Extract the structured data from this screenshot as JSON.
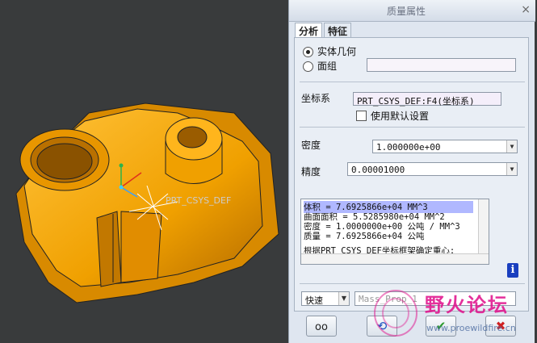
{
  "dialog": {
    "title": "质量属性",
    "tabs": [
      "分析",
      "特征"
    ],
    "options": {
      "solid": "实体几何",
      "quilt": "面组"
    },
    "coord_label": "坐标系",
    "coord_value": "PRT_CSYS_DEF:F4(坐标系)",
    "use_default": "使用默认设置",
    "density_label": "密度",
    "density_value": "1.000000e+00",
    "precision_label": "精度",
    "precision_value": "0.00001000",
    "results": [
      "体积 =  7.6925866e+04  MM^3",
      "曲面面积 =  5.5285980e+04  MM^2",
      "密度 =  1.0000000e+00 公吨 / MM^3",
      "质量 =  7.6925866e+04 公吨",
      "根据PRT_CSYS_DEF坐标框架确定重心:"
    ],
    "mode": "快速",
    "name_placeholder": "Mass_Prop_1"
  },
  "viewport": {
    "csys_label": "PRT_CSYS_DEF"
  },
  "watermark": {
    "text": "野火论坛",
    "url": "www.proewildfire.cn"
  },
  "colors": {
    "part": "#f5a000",
    "background": "#393b3c",
    "selection": "#b0b8ff"
  }
}
